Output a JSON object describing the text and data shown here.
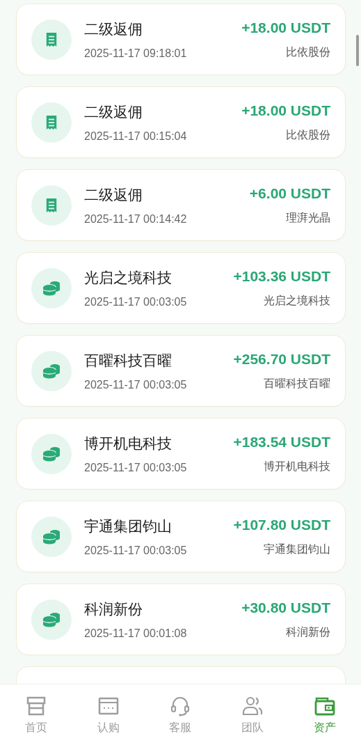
{
  "records": [
    {
      "kind": "receipt",
      "title": "二级返佣",
      "time": "2025-11-17 09:18:01",
      "amount": "+18.00 USDT",
      "source": "比依股份"
    },
    {
      "kind": "receipt",
      "title": "二级返佣",
      "time": "2025-11-17 00:15:04",
      "amount": "+18.00 USDT",
      "source": "比依股份"
    },
    {
      "kind": "receipt",
      "title": "二级返佣",
      "time": "2025-11-17 00:14:42",
      "amount": "+6.00 USDT",
      "source": "理湃光晶"
    },
    {
      "kind": "coins",
      "title": "光启之境科技",
      "time": "2025-11-17 00:03:05",
      "amount": "+103.36 USDT",
      "source": "光启之境科技"
    },
    {
      "kind": "coins",
      "title": "百曜科技百曜",
      "time": "2025-11-17 00:03:05",
      "amount": "+256.70 USDT",
      "source": "百曜科技百曜"
    },
    {
      "kind": "coins",
      "title": "博开机电科技",
      "time": "2025-11-17 00:03:05",
      "amount": "+183.54 USDT",
      "source": "博开机电科技"
    },
    {
      "kind": "coins",
      "title": "宇通集团钧山",
      "time": "2025-11-17 00:03:05",
      "amount": "+107.80 USDT",
      "source": "宇通集团钧山"
    },
    {
      "kind": "coins",
      "title": "科润新份",
      "time": "2025-11-17 00:01:08",
      "amount": "+30.80 USDT",
      "source": "科润新份"
    }
  ],
  "tabs": [
    {
      "kind": "home",
      "label": "首页",
      "selected": false
    },
    {
      "kind": "card",
      "label": "认购",
      "selected": false
    },
    {
      "kind": "headset",
      "label": "客服",
      "selected": false
    },
    {
      "kind": "team",
      "label": "团队",
      "selected": false
    },
    {
      "kind": "wallet",
      "label": "资产",
      "selected": true
    }
  ]
}
